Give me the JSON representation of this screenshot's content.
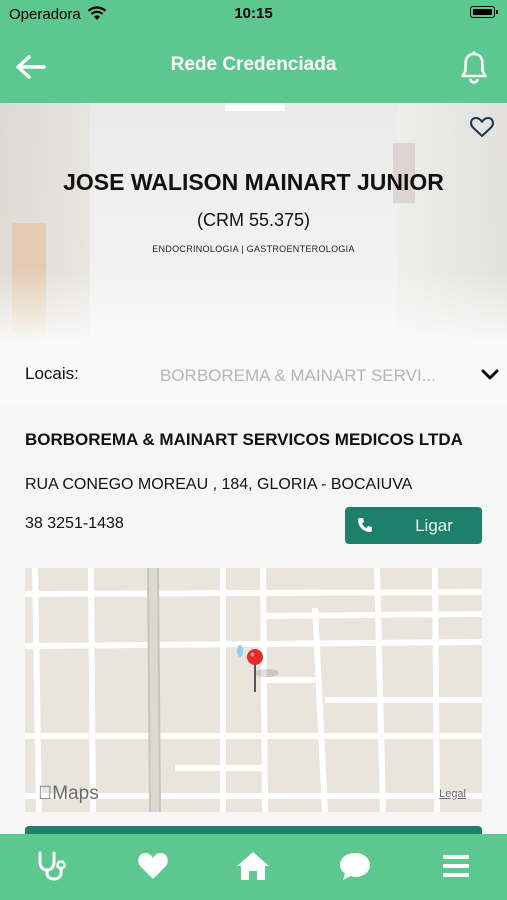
{
  "status_bar": {
    "carrier": "Operadora",
    "time": "10:15"
  },
  "nav": {
    "title": "Rede Credenciada"
  },
  "doctor": {
    "name": "JOSE WALISON MAINART JUNIOR",
    "crm": "(CRM 55.375)",
    "specialty": "ENDOCRINOLOGIA | GASTROENTEROLOGIA"
  },
  "locais": {
    "label": "Locais:",
    "selected": "BORBOREMA & MAINART SERVI..."
  },
  "place": {
    "name": "BORBOREMA & MAINART SERVICOS MEDICOS LTDA",
    "address": "RUA CONEGO MOREAU , 184, GLORIA - BOCAIUVA",
    "phone": "38 3251-1438",
    "call_label": "Ligar"
  },
  "map": {
    "brand": "Maps",
    "legal": "Legal"
  },
  "colors": {
    "header": "#5cc890",
    "button": "#1e7f6b"
  },
  "tabbar": {
    "items": [
      {
        "icon": "stethoscope-icon"
      },
      {
        "icon": "heart-icon"
      },
      {
        "icon": "home-icon"
      },
      {
        "icon": "chat-icon"
      },
      {
        "icon": "menu-icon"
      }
    ]
  }
}
